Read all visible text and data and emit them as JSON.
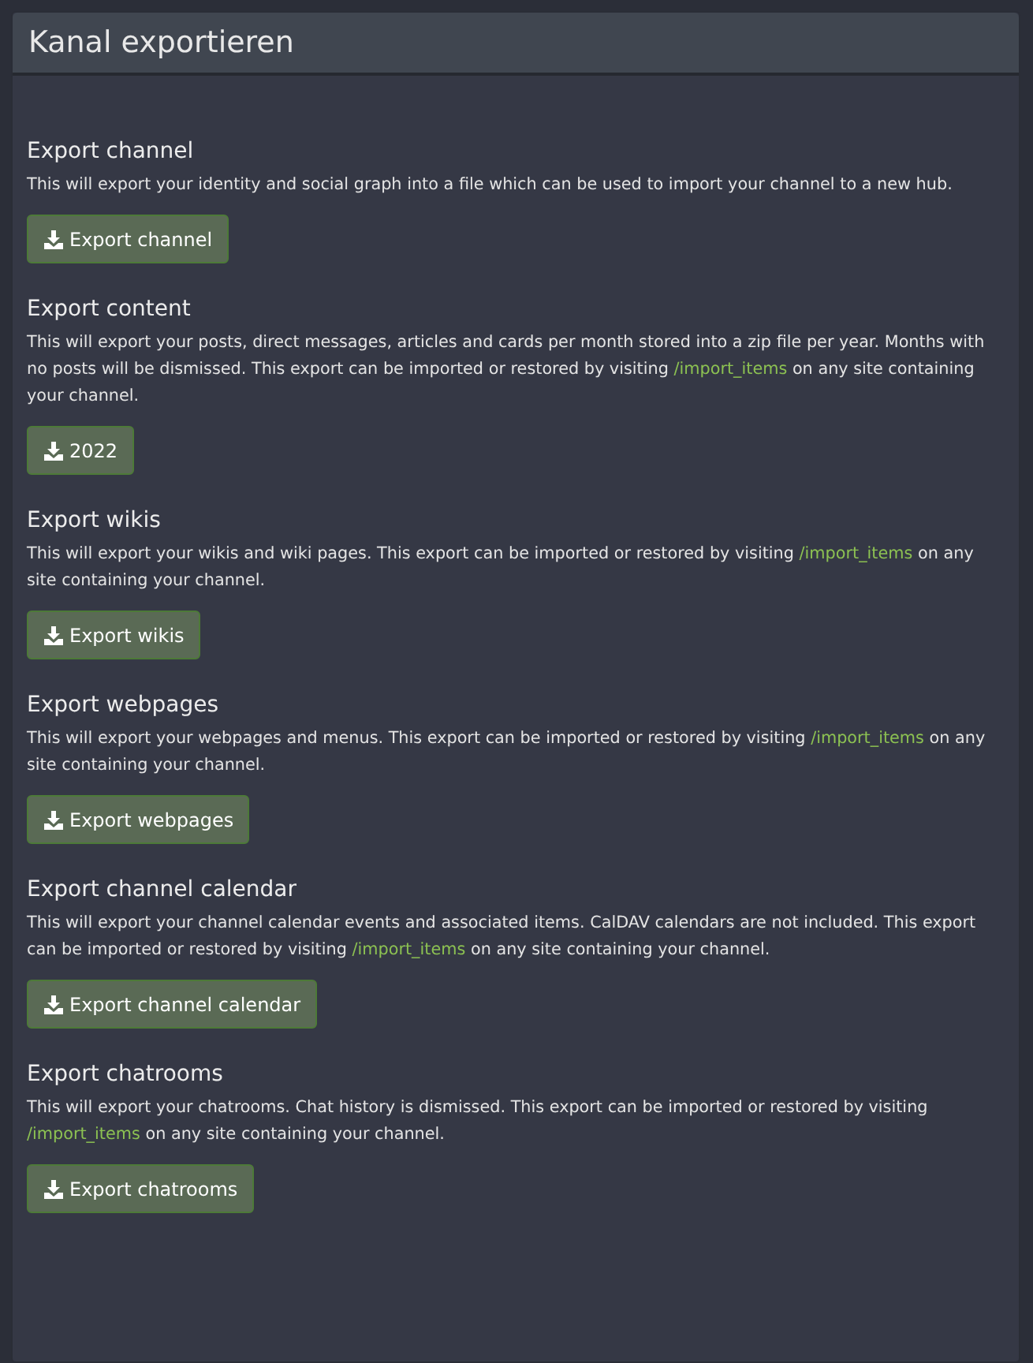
{
  "panel": {
    "title": "Kanal exportieren"
  },
  "sections": [
    {
      "title": "Export channel",
      "description": [
        {
          "kind": "text",
          "text": "This will export your identity and social graph into a file which can be used to import your channel to a new hub."
        }
      ],
      "button": "Export channel"
    },
    {
      "title": "Export content",
      "description": [
        {
          "kind": "text",
          "text": "This will export your posts, direct messages, articles and cards per month stored into a zip file per year. Months with no posts will be dismissed. This export can be imported or restored by visiting"
        },
        {
          "kind": "link",
          "text": "/import_items"
        },
        {
          "kind": "text",
          "text": "on any site containing your channel."
        }
      ],
      "button": "2022"
    },
    {
      "title": "Export wikis",
      "description": [
        {
          "kind": "text",
          "text": "This will export your wikis and wiki pages. This export can be imported or restored by visiting"
        },
        {
          "kind": "link",
          "text": "/import_items"
        },
        {
          "kind": "text",
          "text": "on any site containing your channel."
        }
      ],
      "button": "Export wikis"
    },
    {
      "title": "Export webpages",
      "description": [
        {
          "kind": "text",
          "text": "This will export your webpages and menus. This export can be imported or restored by visiting"
        },
        {
          "kind": "link",
          "text": "/import_items"
        },
        {
          "kind": "text",
          "text": "on any site containing your channel."
        }
      ],
      "button": "Export webpages"
    },
    {
      "title": "Export channel calendar",
      "description": [
        {
          "kind": "text",
          "text": "This will export your channel calendar events and associated items. CalDAV calendars are not included. This export can be imported or restored by visiting"
        },
        {
          "kind": "link",
          "text": "/import_items"
        },
        {
          "kind": "text",
          "text": "on any site containing your channel."
        }
      ],
      "button": "Export channel calendar"
    },
    {
      "title": "Export chatrooms",
      "description": [
        {
          "kind": "text",
          "text": "This will export your chatrooms. Chat history is dismissed. This export can be imported or restored by visiting"
        },
        {
          "kind": "link",
          "text": "/import_items"
        },
        {
          "kind": "text",
          "text": "on any site containing your channel."
        }
      ],
      "button": "Export chatrooms"
    }
  ]
}
